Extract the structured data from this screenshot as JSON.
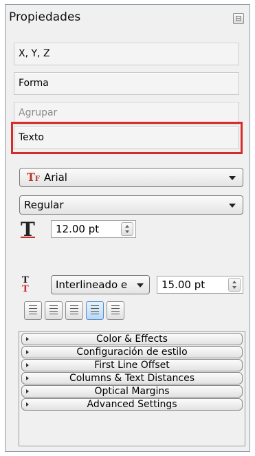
{
  "panel": {
    "title": "Propiedades",
    "close_symbol": "⊟"
  },
  "sections": [
    {
      "label": "X, Y, Z",
      "disabled": false
    },
    {
      "label": "Forma",
      "disabled": false
    },
    {
      "label": "Agrupar",
      "disabled": true
    },
    {
      "label": "Texto",
      "disabled": false
    }
  ],
  "highlight_color": "#d52b2b",
  "text": {
    "font_family": "Arial",
    "font_style": "Regular",
    "font_size": "12.00 pt",
    "line_spacing_mode": "Interlineado e",
    "line_spacing_value": "15.00 pt",
    "alignment_active": 3
  },
  "subsections": [
    "Color & Effects",
    "Configuración de estilo",
    "First Line Offset",
    "Columns & Text Distances",
    "Optical Margins",
    "Advanced Settings"
  ]
}
